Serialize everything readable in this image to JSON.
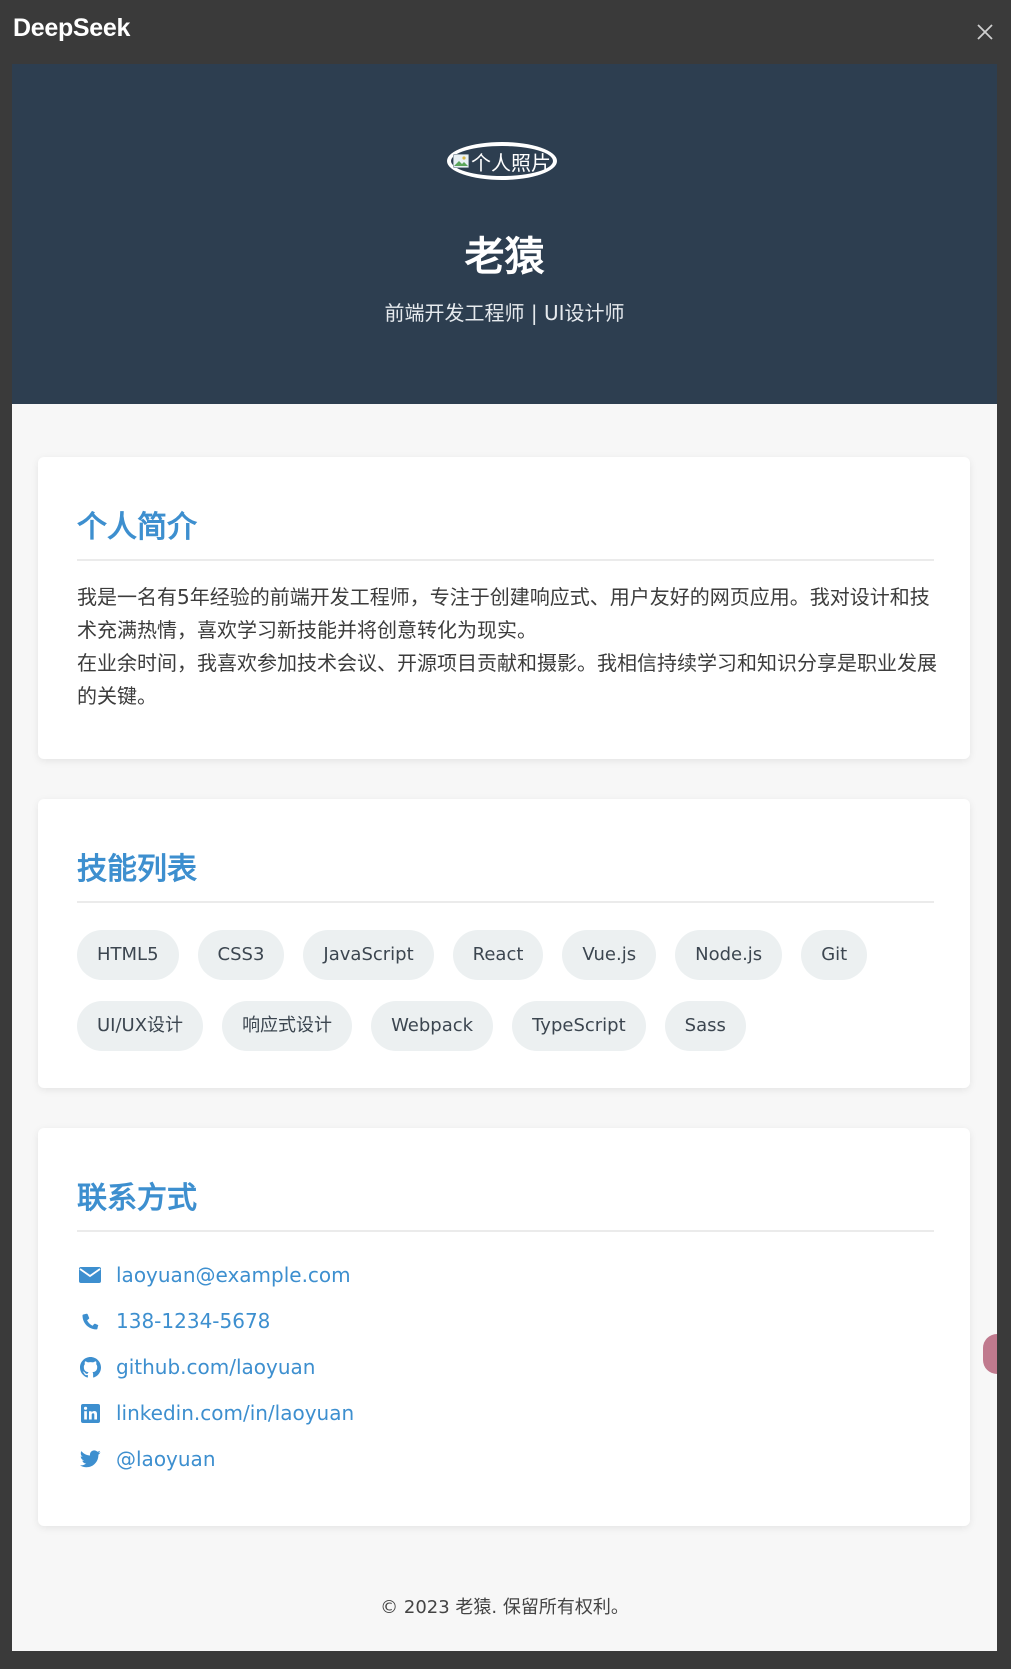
{
  "app": {
    "title": "DeepSeek",
    "close_icon": "close-icon"
  },
  "hero": {
    "avatar_alt": "个人照片",
    "name": "老猿",
    "subtitle": "前端开发工程师 | UI设计师"
  },
  "about": {
    "title": "个人简介",
    "paragraphs": [
      "我是一名有5年经验的前端开发工程师，专注于创建响应式、用户友好的网页应用。我对设计和技术充满热情，喜欢学习新技能并将创意转化为现实。",
      "在业余时间，我喜欢参加技术会议、开源项目贡献和摄影。我相信持续学习和知识分享是职业发展的关键。"
    ]
  },
  "skills": {
    "title": "技能列表",
    "items": [
      "HTML5",
      "CSS3",
      "JavaScript",
      "React",
      "Vue.js",
      "Node.js",
      "Git",
      "UI/UX设计",
      "响应式设计",
      "Webpack",
      "TypeScript",
      "Sass"
    ]
  },
  "contact": {
    "title": "联系方式",
    "items": [
      {
        "icon": "envelope-icon",
        "text": "laoyuan@example.com"
      },
      {
        "icon": "phone-icon",
        "text": "138-1234-5678"
      },
      {
        "icon": "github-icon",
        "text": "github.com/laoyuan"
      },
      {
        "icon": "linkedin-icon",
        "text": "linkedin.com/in/laoyuan"
      },
      {
        "icon": "twitter-icon",
        "text": "@laoyuan"
      }
    ]
  },
  "footer": {
    "text": "© 2023 老猿. 保留所有权利。"
  },
  "colors": {
    "hero_bg": "#2d3e50",
    "accent": "#3d8fcf",
    "page_bg": "#f7f7f7",
    "tag_bg": "#ecf0f1"
  }
}
